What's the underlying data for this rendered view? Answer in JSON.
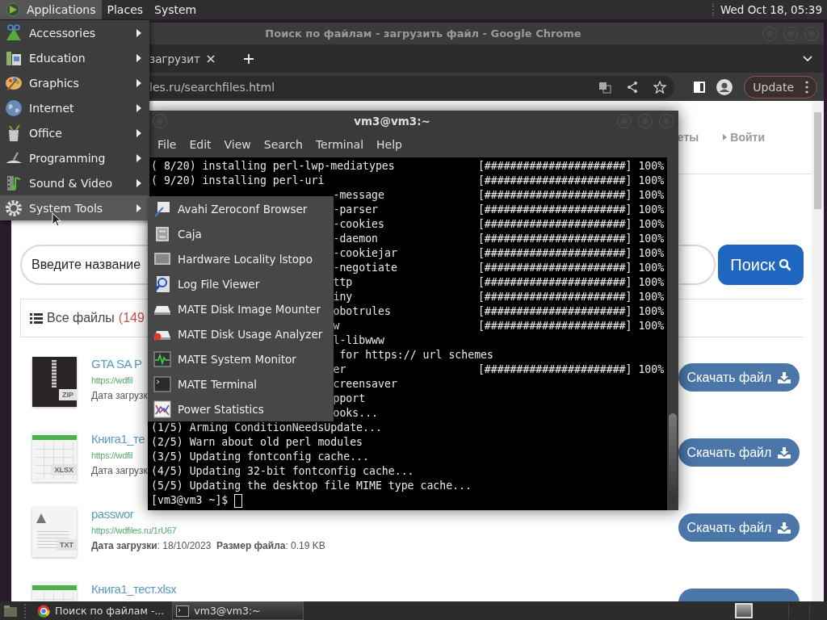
{
  "top_panel": {
    "menus": [
      {
        "label": "Applications",
        "selected": true,
        "logo": true
      },
      {
        "label": "Places",
        "selected": false
      },
      {
        "label": "System",
        "selected": false
      }
    ],
    "clock": "Wed Oct 18, 05:39"
  },
  "applications_menu": {
    "items": [
      {
        "label": "Accessories",
        "kind": "accessories",
        "selected": false
      },
      {
        "label": "Education",
        "kind": "education",
        "selected": false
      },
      {
        "label": "Graphics",
        "kind": "graphics",
        "selected": false
      },
      {
        "label": "Internet",
        "kind": "internet",
        "selected": false
      },
      {
        "label": "Office",
        "kind": "office",
        "selected": false
      },
      {
        "label": "Programming",
        "kind": "programming",
        "selected": false
      },
      {
        "label": "Sound & Video",
        "kind": "media",
        "selected": false
      },
      {
        "label": "System Tools",
        "kind": "system",
        "selected": true
      }
    ]
  },
  "system_tools_submenu": {
    "items": [
      {
        "label": "Avahi Zeroconf Browser",
        "kind": "avahi"
      },
      {
        "label": "Caja",
        "kind": "caja"
      },
      {
        "label": "Hardware Locality lstopo",
        "kind": "lstopo"
      },
      {
        "label": "Log File Viewer",
        "kind": "log"
      },
      {
        "label": "MATE Disk Image Mounter",
        "kind": "mounter"
      },
      {
        "label": "MATE Disk Usage Analyzer",
        "kind": "usage"
      },
      {
        "label": "MATE System Monitor",
        "kind": "monitor"
      },
      {
        "label": "MATE Terminal",
        "kind": "terminal"
      },
      {
        "label": "Power Statistics",
        "kind": "power"
      }
    ]
  },
  "browser": {
    "title": "Поиск по файлам - загрузить файл - Google Chrome",
    "tab": {
      "label": "загрузит"
    },
    "address": "les.ru/searchfiles.html",
    "update_button": "Update",
    "page": {
      "nav": [
        {
          "label": "еты",
          "caret": false
        },
        {
          "label": "Войти",
          "caret": true
        }
      ],
      "search": {
        "value": "Введите название",
        "button": "Поиск"
      },
      "files_header": {
        "title": "Все файлы",
        "count": "(149"
      },
      "files": [
        {
          "kind": "archive",
          "tag": "ZIP",
          "title": "GTA SA P",
          "url": "https://wdfil",
          "meta": "Дата загрузк",
          "button": "Скачать файл"
        },
        {
          "kind": "spreadsheet",
          "tag": "XLSX",
          "title": "Книга1_те",
          "url": "https://wdfil",
          "meta": "Дата загрузк",
          "button": "Скачать файл"
        },
        {
          "kind": "text",
          "tag": "TXT",
          "title": "passwor",
          "url": "https://wdfiles.ru/1rU67",
          "meta": "**Дата загрузки**: 18/10/2023  **Размер файла**: 0.19 KB",
          "button": "Скачать файл"
        },
        {
          "kind": "spreadsheet",
          "title": "Книга1_тест.xlsx"
        }
      ]
    }
  },
  "terminal": {
    "title": "vm3@vm3:~",
    "menus": [
      "File",
      "Edit",
      "View",
      "Search",
      "Terminal",
      "Help"
    ],
    "lines": [
      {
        "kind": "full",
        "text": "( 8/20) installing perl-lwp-mediatypes",
        "progress": "[######################] 100%"
      },
      {
        "kind": "full",
        "text": "( 9/20) installing perl-uri",
        "progress": "[######################] 100%"
      },
      {
        "kind": "tail",
        "text": "-message",
        "progress": "[######################] 100%"
      },
      {
        "kind": "tail",
        "text": "-parser",
        "progress": "[######################] 100%"
      },
      {
        "kind": "tail",
        "text": "-cookies",
        "progress": "[######################] 100%"
      },
      {
        "kind": "tail",
        "text": "-daemon",
        "progress": "[######################] 100%"
      },
      {
        "kind": "tail",
        "text": "-cookiejar",
        "progress": "[######################] 100%"
      },
      {
        "kind": "tail",
        "text": "-negotiate",
        "progress": "[######################] 100%"
      },
      {
        "kind": "tail",
        "text": "ttp",
        "progress": "[######################] 100%"
      },
      {
        "kind": "tail",
        "text": "iny",
        "progress": "[######################] 100%"
      },
      {
        "kind": "tail",
        "text": "obotrules",
        "progress": "[######################] 100%"
      },
      {
        "kind": "tail",
        "text": "w",
        "progress": "[######################] 100%"
      },
      {
        "kind": "tail",
        "text": "l-libwww"
      },
      {
        "kind": "tail",
        "text": " for https:// url schemes"
      },
      {
        "kind": "tail",
        "text": "er",
        "progress": "[######################] 100%"
      },
      {
        "kind": "tail",
        "text": "creensaver"
      },
      {
        "kind": "tail",
        "text": "pport"
      },
      {
        "kind": "tail",
        "text": "ooks..."
      },
      {
        "kind": "full",
        "text": "(1/5) Arming ConditionNeedsUpdate..."
      },
      {
        "kind": "full",
        "text": "(2/5) Warn about old perl modules"
      },
      {
        "kind": "full",
        "text": "(3/5) Updating fontconfig cache..."
      },
      {
        "kind": "full",
        "text": "(4/5) Updating 32-bit fontconfig cache..."
      },
      {
        "kind": "full",
        "text": "(5/5) Updating the desktop file MIME type cache..."
      }
    ],
    "prompt": "[vm3@vm3 ~]$"
  },
  "taskbar": {
    "items": [
      {
        "label": "Поиск по файлам -...",
        "kind": "browser",
        "selected": false
      },
      {
        "label": "vm3@vm3:~",
        "kind": "terminal",
        "selected": true
      }
    ]
  }
}
